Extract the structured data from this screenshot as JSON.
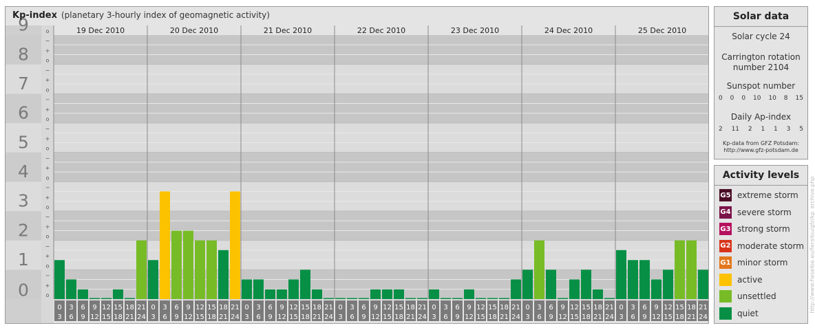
{
  "header": {
    "title": "Kp-index",
    "subtitle": "(planetary 3-hourly index of geomagnetic activity)"
  },
  "chart_data": {
    "type": "bar",
    "title": "Kp-index",
    "subtitle": "(planetary 3-hourly index of geomagnetic activity)",
    "ylim": [
      0,
      9
    ],
    "y_ticks": [
      "0",
      "1",
      "2",
      "3",
      "4",
      "5",
      "6",
      "7",
      "8",
      "9"
    ],
    "sub_ticks": [
      "o",
      "+",
      "−"
    ],
    "days": [
      "19 Dec 2010",
      "20 Dec 2010",
      "21 Dec 2010",
      "22 Dec 2010",
      "23 Dec 2010",
      "24 Dec 2010",
      "25 Dec 2010"
    ],
    "slot_start": [
      "0",
      "3",
      "6",
      "9",
      "12",
      "15",
      "18",
      "21"
    ],
    "slot_end": [
      "3",
      "6",
      "9",
      "12",
      "15",
      "18",
      "21",
      "24"
    ],
    "values": [
      [
        1.33,
        0.67,
        0.33,
        0,
        0,
        0.33,
        0,
        2.0
      ],
      [
        1.33,
        3.67,
        2.33,
        2.33,
        2.0,
        2.0,
        1.67,
        3.67
      ],
      [
        0.67,
        0.67,
        0.33,
        0.33,
        0.67,
        1.0,
        0.33,
        0
      ],
      [
        0,
        0,
        0,
        0.33,
        0.33,
        0.33,
        0,
        0
      ],
      [
        0.33,
        0,
        0,
        0.33,
        0,
        0,
        0,
        0.67
      ],
      [
        1.0,
        2.0,
        1.0,
        0,
        0.67,
        1.0,
        0.33,
        0
      ],
      [
        1.67,
        1.33,
        1.33,
        0.67,
        1.0,
        2.0,
        2.0,
        1.0
      ]
    ],
    "grid": true
  },
  "solar": {
    "title": "Solar data",
    "cycle": "Solar cycle 24",
    "carrington_1": "Carrington rotation",
    "carrington_2": "number 2104",
    "sunspot_label": "Sunspot number",
    "sunspot_values": [
      "0",
      "0",
      "0",
      "10",
      "10",
      "8",
      "15"
    ],
    "ap_label": "Daily Ap-index",
    "ap_values": [
      "2",
      "11",
      "2",
      "1",
      "1",
      "3",
      "5"
    ],
    "credit_1": "Kp-data from GFZ Potsdam:",
    "credit_2": "http://www.gfz-potsdam.de"
  },
  "activity": {
    "title": "Activity levels",
    "levels": [
      {
        "code": "G5",
        "label": "extreme storm",
        "color": "#4b0d26"
      },
      {
        "code": "G4",
        "label": "severe storm",
        "color": "#7a1449"
      },
      {
        "code": "G3",
        "label": "strong storm",
        "color": "#b5105e"
      },
      {
        "code": "G2",
        "label": "moderate storm",
        "color": "#d8341a"
      },
      {
        "code": "G1",
        "label": "minor storm",
        "color": "#e3771c"
      },
      {
        "code": "",
        "label": "active",
        "color": "#fcc200"
      },
      {
        "code": "",
        "label": "unsettled",
        "color": "#77bc26"
      },
      {
        "code": "",
        "label": "quiet",
        "color": "#079045"
      }
    ]
  },
  "side_credit": "http://www.fieselbe.eu/feralbu/gfz/kp_archive.php",
  "colors": {
    "quiet": "#079045",
    "unsettled": "#77bc26",
    "active": "#fcc200",
    "band_dark": "#c6c6c6",
    "band_light": "#dcdcdc"
  }
}
